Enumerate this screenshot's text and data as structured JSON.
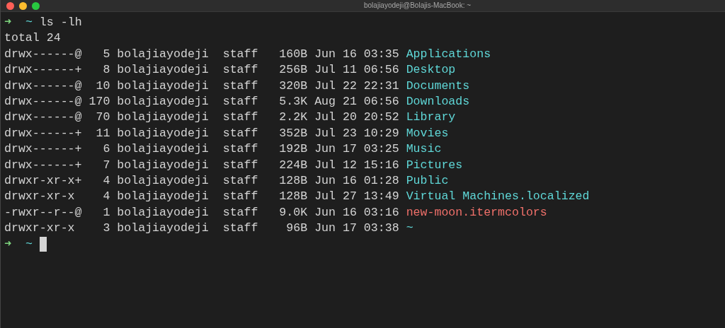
{
  "window": {
    "title": "bolajiayodeji@Bolajis-MacBook: ~"
  },
  "command_prompt": {
    "arrow": "➜",
    "dir": "~",
    "command": "ls -lh"
  },
  "output_total": "total 24",
  "entries": [
    {
      "details": "drwx------@   5 bolajiayodeji  staff   160B Jun 16 03:35",
      "name": "Applications",
      "kind": "dir"
    },
    {
      "details": "drwx------+   8 bolajiayodeji  staff   256B Jul 11 06:56",
      "name": "Desktop",
      "kind": "dir"
    },
    {
      "details": "drwx------@  10 bolajiayodeji  staff   320B Jul 22 22:31",
      "name": "Documents",
      "kind": "dir"
    },
    {
      "details": "drwx------@ 170 bolajiayodeji  staff   5.3K Aug 21 06:56",
      "name": "Downloads",
      "kind": "dir"
    },
    {
      "details": "drwx------@  70 bolajiayodeji  staff   2.2K Jul 20 20:52",
      "name": "Library",
      "kind": "dir"
    },
    {
      "details": "drwx------+  11 bolajiayodeji  staff   352B Jul 23 10:29",
      "name": "Movies",
      "kind": "dir"
    },
    {
      "details": "drwx------+   6 bolajiayodeji  staff   192B Jun 17 03:25",
      "name": "Music",
      "kind": "dir"
    },
    {
      "details": "drwx------+   7 bolajiayodeji  staff   224B Jul 12 15:16",
      "name": "Pictures",
      "kind": "dir"
    },
    {
      "details": "drwxr-xr-x+   4 bolajiayodeji  staff   128B Jun 16 01:28",
      "name": "Public",
      "kind": "dir"
    },
    {
      "details": "drwxr-xr-x    4 bolajiayodeji  staff   128B Jul 27 13:49",
      "name": "Virtual Machines.localized",
      "kind": "dir"
    },
    {
      "details": "-rwxr--r--@   1 bolajiayodeji  staff   9.0K Jun 16 03:16",
      "name": "new-moon.itermcolors",
      "kind": "file"
    },
    {
      "details": "drwxr-xr-x    3 bolajiayodeji  staff    96B Jun 17 03:38",
      "name": "~",
      "kind": "dir"
    }
  ],
  "current_prompt": {
    "arrow": "➜",
    "dir": "~"
  }
}
